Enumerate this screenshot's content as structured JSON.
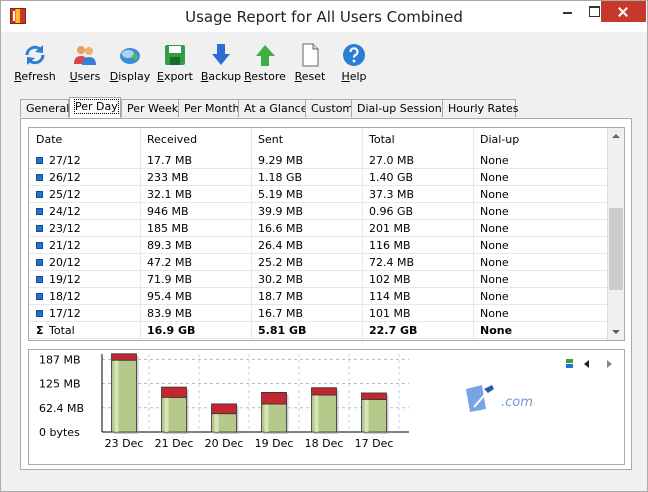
{
  "window": {
    "title": "Usage Report for All Users Combined"
  },
  "toolbar": {
    "buttons": [
      {
        "label": "Refresh",
        "icon": "refresh-icon"
      },
      {
        "label": "Users",
        "icon": "users-icon"
      },
      {
        "label": "Display",
        "icon": "display-icon"
      },
      {
        "label": "Export",
        "icon": "export-icon"
      },
      {
        "label": "Backup",
        "icon": "backup-icon"
      },
      {
        "label": "Restore",
        "icon": "restore-icon"
      },
      {
        "label": "Reset",
        "icon": "reset-icon"
      },
      {
        "label": "Help",
        "icon": "help-icon"
      }
    ]
  },
  "tabs": [
    {
      "label": "General",
      "active": false
    },
    {
      "label": "Per Day",
      "active": true
    },
    {
      "label": "Per Week",
      "active": false
    },
    {
      "label": "Per Month",
      "active": false
    },
    {
      "label": "At a Glance",
      "active": false
    },
    {
      "label": "Custom",
      "active": false
    },
    {
      "label": "Dial-up Sessions",
      "active": false
    },
    {
      "label": "Hourly Rates",
      "active": false
    }
  ],
  "table": {
    "columns": [
      "Date",
      "Received",
      "Sent",
      "Total",
      "Dial-up"
    ],
    "rows": [
      [
        "27/12",
        "17.7 MB",
        "9.29 MB",
        "27.0 MB",
        "None"
      ],
      [
        "26/12",
        "233 MB",
        "1.18 GB",
        "1.40 GB",
        "None"
      ],
      [
        "25/12",
        "32.1 MB",
        "5.19 MB",
        "37.3 MB",
        "None"
      ],
      [
        "24/12",
        "946 MB",
        "39.9 MB",
        "0.96 GB",
        "None"
      ],
      [
        "23/12",
        "185 MB",
        "16.6 MB",
        "201 MB",
        "None"
      ],
      [
        "21/12",
        "89.3 MB",
        "26.4 MB",
        "116 MB",
        "None"
      ],
      [
        "20/12",
        "47.2 MB",
        "25.2 MB",
        "72.4 MB",
        "None"
      ],
      [
        "19/12",
        "71.9 MB",
        "30.2 MB",
        "102 MB",
        "None"
      ],
      [
        "18/12",
        "95.4 MB",
        "18.7 MB",
        "114 MB",
        "None"
      ],
      [
        "17/12",
        "83.9 MB",
        "16.7 MB",
        "101 MB",
        "None"
      ]
    ],
    "total": [
      "Total",
      "16.9 GB",
      "5.81 GB",
      "22.7 GB",
      "None"
    ],
    "scroll_position": 0.66
  },
  "chart_data": {
    "type": "bar",
    "stacked": true,
    "categories": [
      "23 Dec",
      "21 Dec",
      "20 Dec",
      "19 Dec",
      "18 Dec",
      "17 Dec"
    ],
    "series": [
      {
        "values": [
          185,
          89.3,
          47.2,
          71.9,
          95.4,
          83.9
        ],
        "color": "#b5c98a"
      },
      {
        "values": [
          16.6,
          26.4,
          25.2,
          30.2,
          18.7,
          16.7
        ],
        "color": "#c0282f"
      }
    ],
    "yticks": [
      "187 MB",
      "125 MB",
      "62.4 MB",
      "0 bytes"
    ],
    "ytick_values": [
      187,
      125,
      62.4,
      0
    ],
    "ylim": [
      0,
      201
    ],
    "grid": true
  },
  "watermark": {
    "text": ".com"
  }
}
